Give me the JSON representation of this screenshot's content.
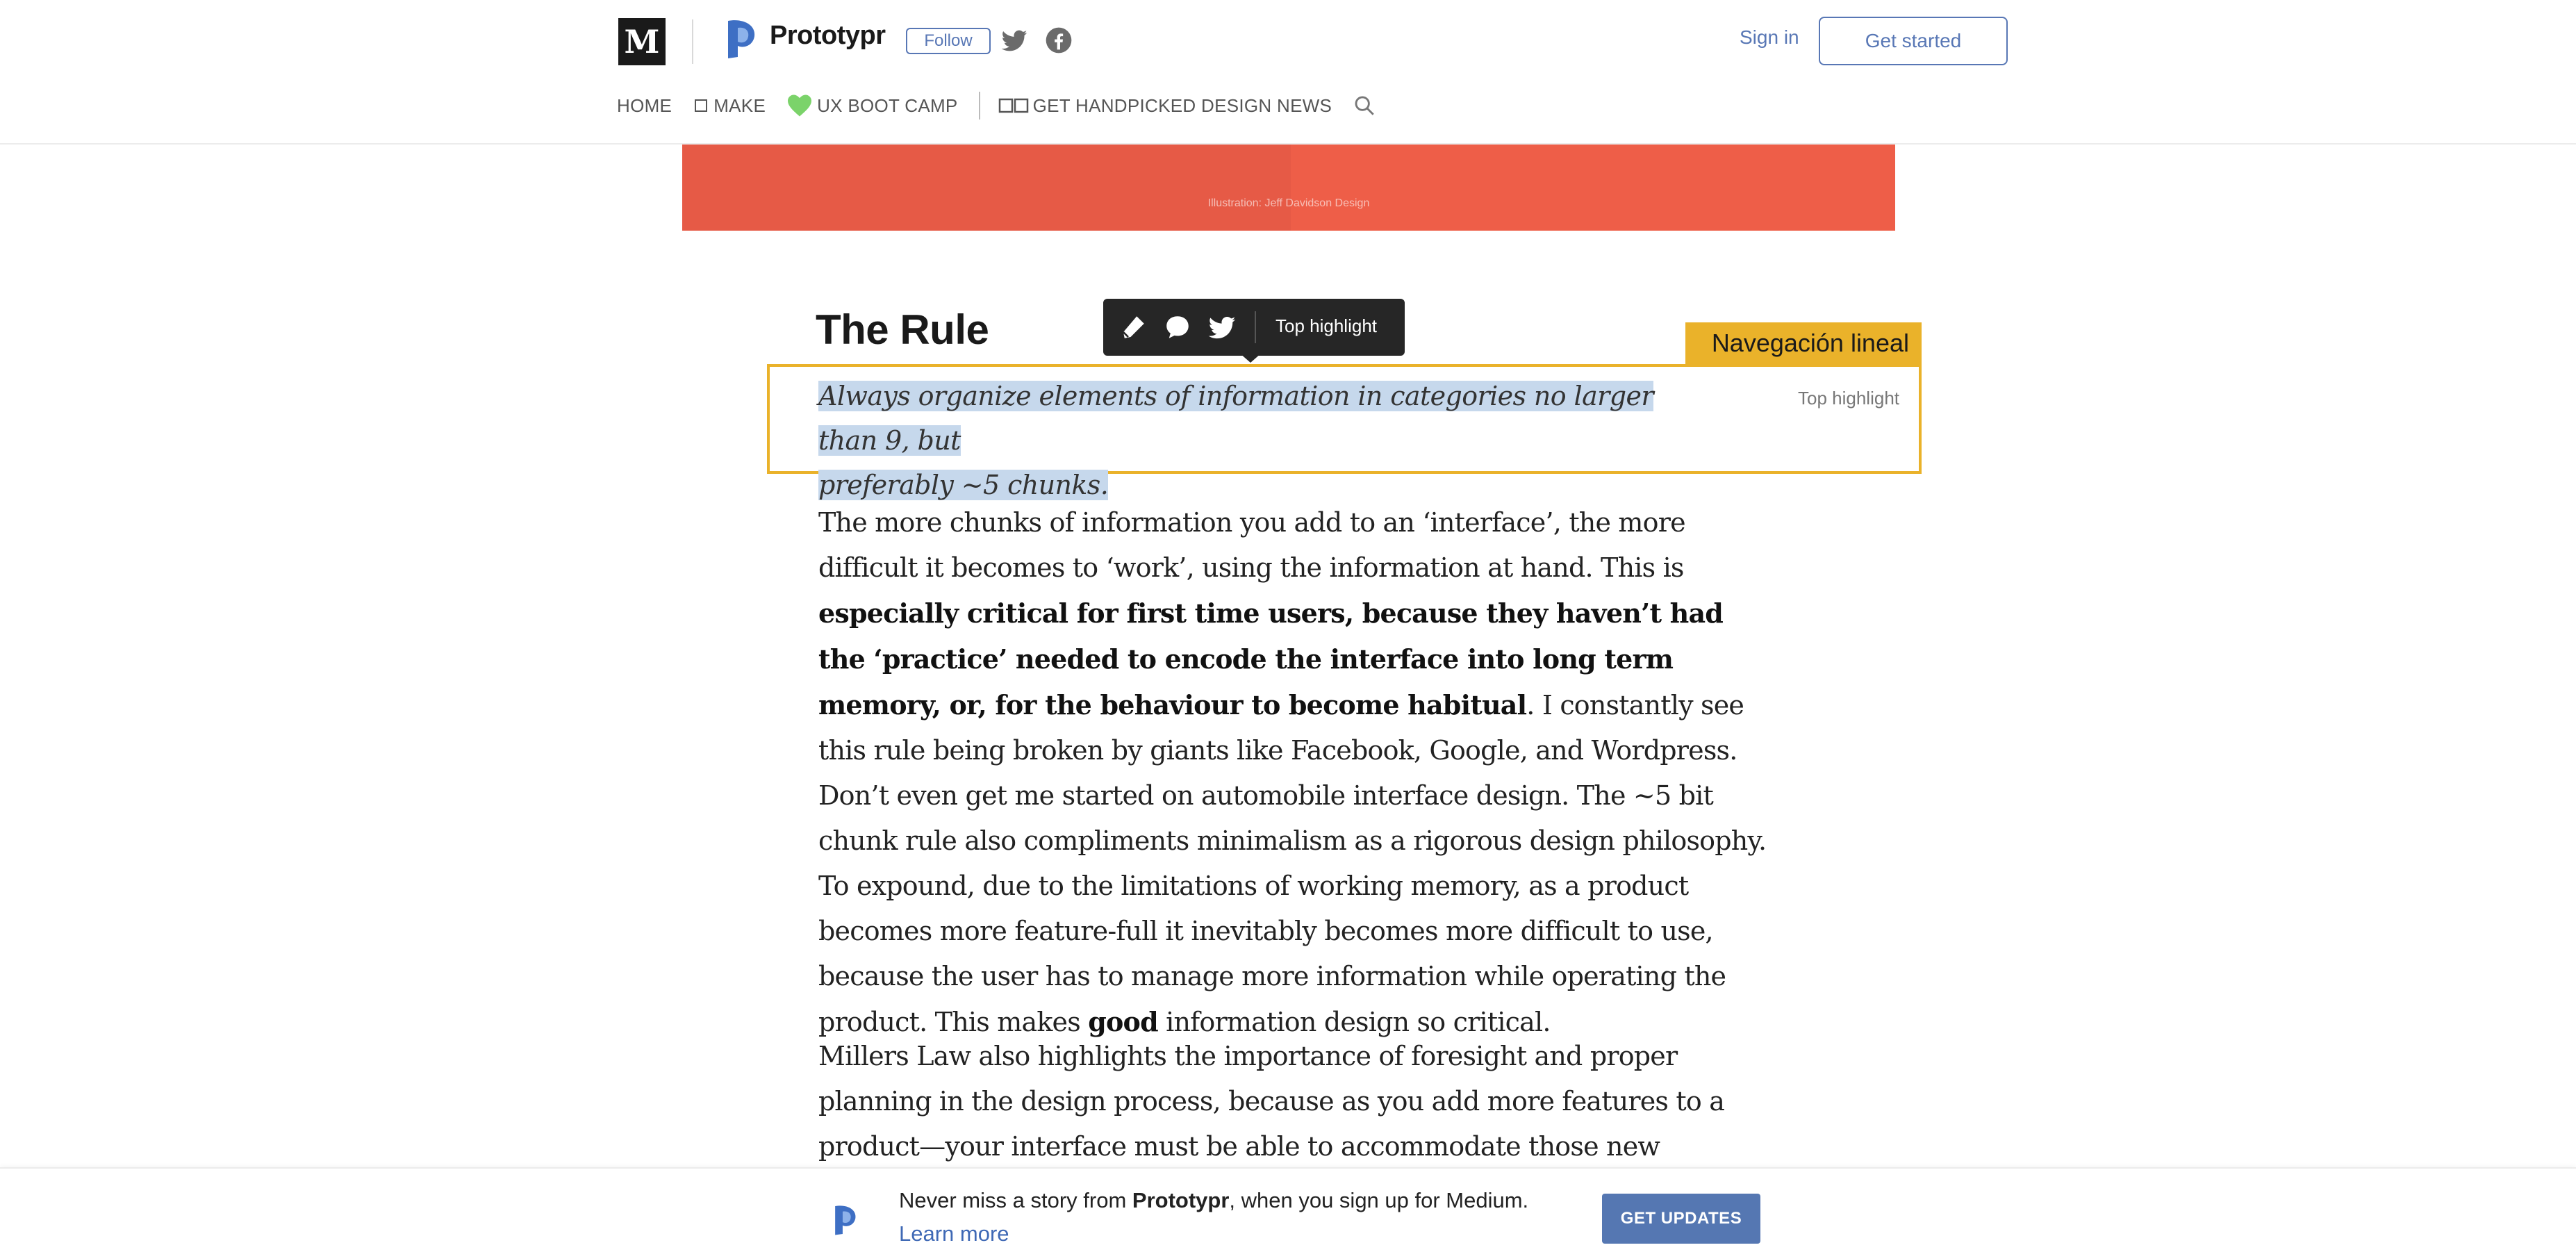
{
  "header": {
    "medium_logo": "M",
    "publication_name": "Prototypr",
    "follow_label": "Follow",
    "sign_in_label": "Sign in",
    "get_started_label": "Get started",
    "nav": [
      {
        "label": "HOME",
        "icon": null
      },
      {
        "label": "MAKE",
        "icon": "square-icon"
      },
      {
        "label": "UX BOOT CAMP",
        "icon": "green-heart-icon"
      },
      {
        "label": "GET HANDPICKED DESIGN NEWS",
        "icon": "open-book-icon"
      }
    ],
    "search_icon": "search-icon"
  },
  "hero": {
    "credit": "Illustration: Jeff Davidson Design"
  },
  "article": {
    "heading": "The Rule",
    "highlight_tooltip": {
      "label": "Top highlight",
      "icons": [
        "pencil-icon",
        "comment-icon",
        "twitter-icon"
      ]
    },
    "annotation_tag": "Navegación lineal",
    "quote_line1": "Always organize elements of information in categories no larger than 9, but",
    "quote_line2": "preferably ~5 chunks.",
    "side_label": "Top highlight",
    "p1": {
      "a": "The more chunks of information you add to an ‘interface’, the more difficult it becomes to ‘work’, using the information at hand. This is ",
      "b": "especially critical for first time users, because they haven’t had the ‘practice’ needed to encode the interface into long term memory, or, for the behaviour to become habitual",
      "c": ". I constantly see this rule being broken by giants like Facebook, Google, and Wordpress. Don’t even get me started on automobile interface design. The ~5 bit chunk rule also compliments minimalism as a rigorous design philosophy. To expound, due to the limitations of working memory, as a product becomes more feature-full it inevitably becomes more difficult to use, because the user has to manage more information while operating the product. This makes ",
      "d": "good",
      "e": " information design so critical."
    },
    "p2": "Millers Law also highlights the importance of foresight and proper planning in the design process, because as you add more features to a product—your interface must be able to accommodate those new features without breaking"
  },
  "banner": {
    "text_before": "Never miss a story from ",
    "publication": "Prototypr",
    "text_after": ", when you sign up for Medium.",
    "learn_more": "Learn more",
    "button_label": "GET UPDATES"
  },
  "colors": {
    "accent": "#5877b5",
    "highlight": "#c6d8ec",
    "annotation": "#eab22a",
    "hero": "#e65a46"
  }
}
